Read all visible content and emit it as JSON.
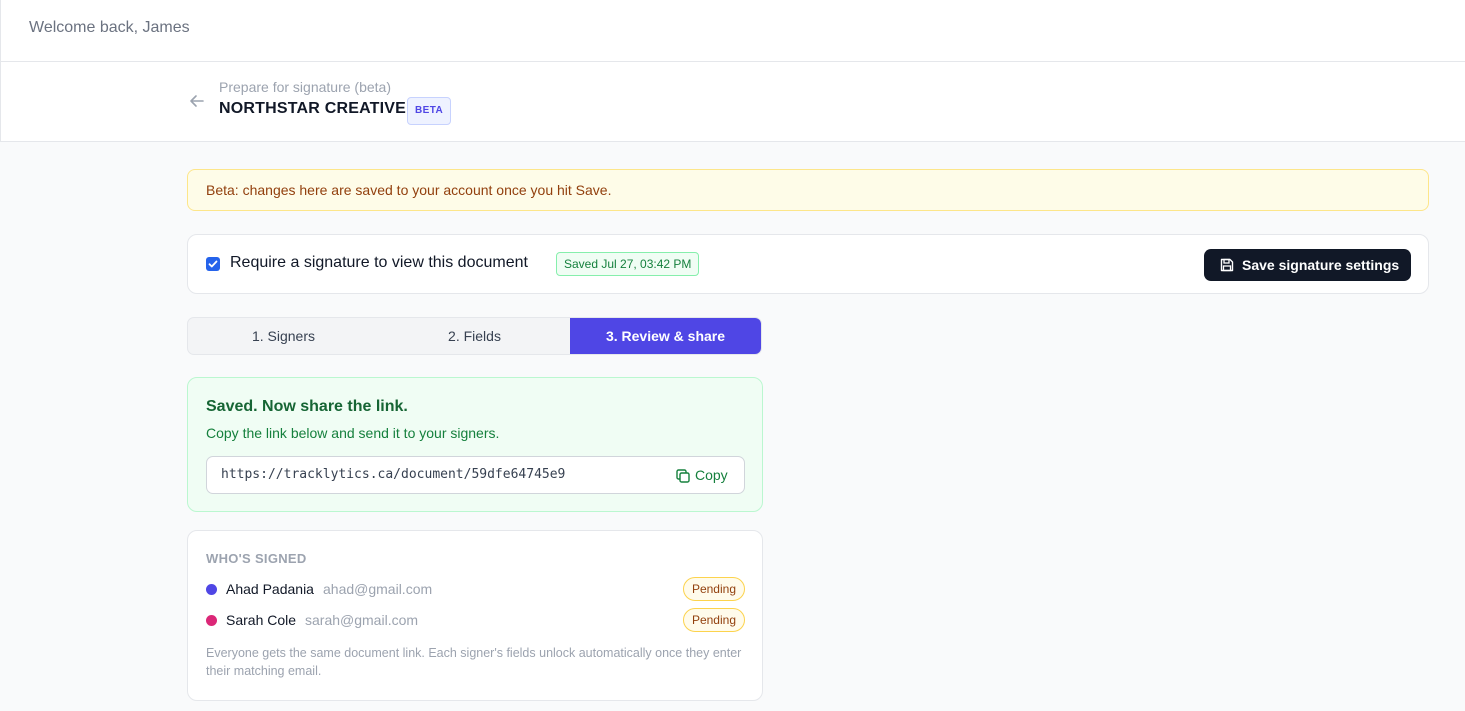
{
  "topbar": {
    "welcome": "Welcome back, James"
  },
  "header": {
    "breadcrumb": "Prepare for signature (beta)",
    "title": "NORTHSTAR CREATIVE",
    "badge": "BETA"
  },
  "notice": {
    "text": "Beta: changes here are saved to your account once you hit Save."
  },
  "settings": {
    "require_label": "Require a signature to view this document",
    "require_checked": true,
    "saved_badge": "Saved Jul 27, 03:42 PM",
    "save_button": "Save signature settings"
  },
  "tabs": [
    {
      "label": "1. Signers",
      "active": false
    },
    {
      "label": "2. Fields",
      "active": false
    },
    {
      "label": "3. Review & share",
      "active": true
    }
  ],
  "share": {
    "title": "Saved. Now share the link.",
    "subtitle": "Copy the link below and send it to your signers.",
    "link": "https://tracklytics.ca/document/59dfe64745e9",
    "copy_label": "Copy"
  },
  "signed": {
    "heading": "WHO'S SIGNED",
    "signers": [
      {
        "name": "Ahad Padania",
        "email": "ahad@gmail.com",
        "status": "Pending",
        "color": "#4f46e5"
      },
      {
        "name": "Sarah Cole",
        "email": "sarah@gmail.com",
        "status": "Pending",
        "color": "#db2777"
      }
    ],
    "note": "Everyone gets the same document link. Each signer's fields unlock automatically once they enter their matching email."
  },
  "icons": {
    "back": "arrow-left-icon",
    "save": "floppy-disk-icon",
    "copy": "copy-icon",
    "checkbox": "checkmark-icon"
  }
}
